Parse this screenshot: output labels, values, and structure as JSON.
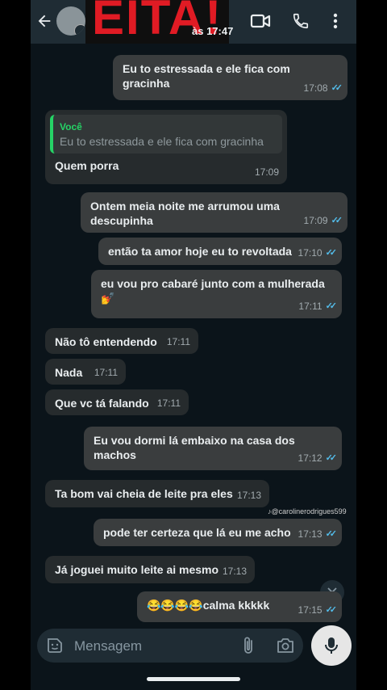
{
  "header": {
    "overlay_title": "EITA!",
    "time_label": "às 17:47"
  },
  "messages": [
    {
      "dir": "out",
      "text": "Eu to estressada e ele fica com gracinha",
      "time": "17:08",
      "read": true
    },
    {
      "dir": "in",
      "quote_author": "Você",
      "quote_text": "Eu to estressada e ele fica com gracinha",
      "text": "Quem porra",
      "time": "17:09"
    },
    {
      "dir": "out",
      "text": "Ontem meia noite me arrumou uma descupinha",
      "time": "17:09",
      "read": true
    },
    {
      "dir": "out",
      "text": "então ta amor hoje eu to revoltada",
      "time": "17:10",
      "read": true
    },
    {
      "dir": "out",
      "text": "eu vou pro cabaré junto com a mulherada💅",
      "time": "17:11",
      "read": true
    },
    {
      "dir": "in",
      "text": "Não tô entendendo",
      "time": "17:11"
    },
    {
      "dir": "in",
      "text": "Nada",
      "time": "17:11"
    },
    {
      "dir": "in",
      "text": "Que vc tá falando",
      "time": "17:11"
    },
    {
      "dir": "out",
      "text": "Eu vou dormi lá embaixo na casa dos machos",
      "time": "17:12",
      "read": true
    },
    {
      "dir": "in",
      "text": "Ta bom  vai cheia de leite pra eles",
      "time": "17:13"
    },
    {
      "dir": "out",
      "text": "pode ter certeza que lá eu me acho",
      "time": "17:13",
      "read": true
    },
    {
      "dir": "in",
      "text": "Já joguei muito leite ai mesmo",
      "time": "17:13"
    },
    {
      "dir": "out",
      "text": "😂😂😂😂calma kkkkk",
      "time": "17:15",
      "read": true
    }
  ],
  "watermark": "@carolinerodrigues599",
  "composer": {
    "placeholder": "Mensagem"
  },
  "icons": [
    "back-arrow-icon",
    "video-call-icon",
    "phone-icon",
    "more-vert-icon",
    "emoji-sticker-icon",
    "attach-icon",
    "camera-icon",
    "mic-icon",
    "scroll-down-icon",
    "tiktok-icon",
    "double-check-icon"
  ]
}
